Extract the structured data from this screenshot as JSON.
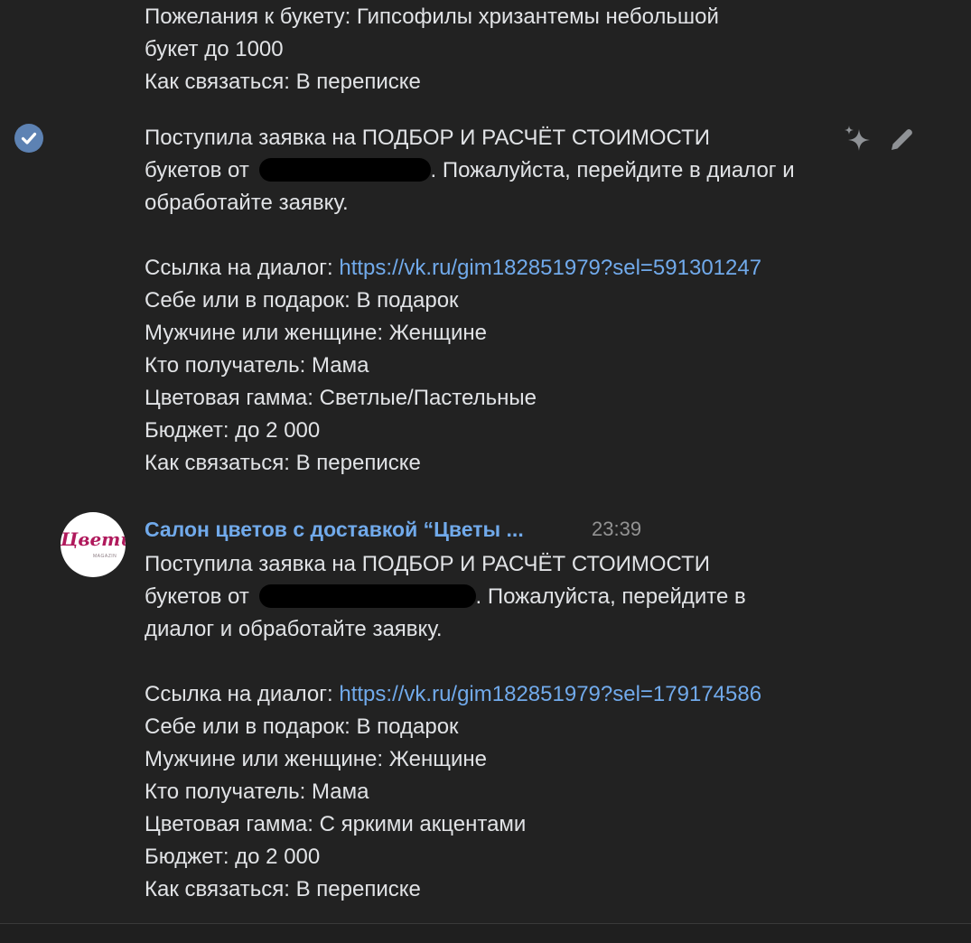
{
  "prev_message": {
    "wishes_line1": "Пожелания к букету: Гипсофилы хризантемы небольшой",
    "wishes_line2": "букет до 1000",
    "contact": "Как связаться: В переписке"
  },
  "message1": {
    "line1": "Поступила заявка на ПОДБОР И РАСЧЁТ СТОИМОСТИ",
    "line2_prefix": "букетов от",
    "line2_suffix": ". Пожалуйста, перейдите в диалог и",
    "line3": "обработайте заявку.",
    "link_label": "Ссылка на диалог: ",
    "link_url": "https://vk.ru/gim182851979?sel=591301247",
    "gift": "Себе или в подарок: В подарок",
    "gender": "Мужчине или женщине: Женщине",
    "recipient": "Кто получатель: Мама",
    "color": "Цветовая гамма: Светлые/Пастельные",
    "budget": "Бюджет: до 2 000",
    "contact": "Как связаться: В переписке"
  },
  "message2": {
    "author": "Салон цветов с доставкой “Цветы ...",
    "time": "23:39",
    "avatar_text": "Цветы",
    "avatar_subtext": "MAGAZIN",
    "line1": "Поступила заявка на ПОДБОР И РАСЧЁТ СТОИМОСТИ",
    "line2_prefix": "букетов от",
    "line2_suffix": ". Пожалуйста, перейдите в",
    "line3": "диалог и обработайте заявку.",
    "link_label": "Ссылка на диалог: ",
    "link_url": "https://vk.ru/gim182851979?sel=179174586",
    "gift": "Себе или в подарок: В подарок",
    "gender": "Мужчине или женщине: Женщине",
    "recipient": "Кто получатель: Мама",
    "color": "Цветовая гамма: С яркими акцентами",
    "budget": "Бюджет: до 2 000",
    "contact": "Как связаться: В переписке"
  },
  "icons": {
    "selected": "check-circle-icon",
    "ai": "sparkles-icon",
    "edit": "pencil-icon"
  },
  "colors": {
    "background": "#222222",
    "text": "#e1e3e6",
    "link": "#71aaeb",
    "time": "#939393",
    "check": "#5d82b3",
    "avatar_brand": "#b0195c"
  }
}
